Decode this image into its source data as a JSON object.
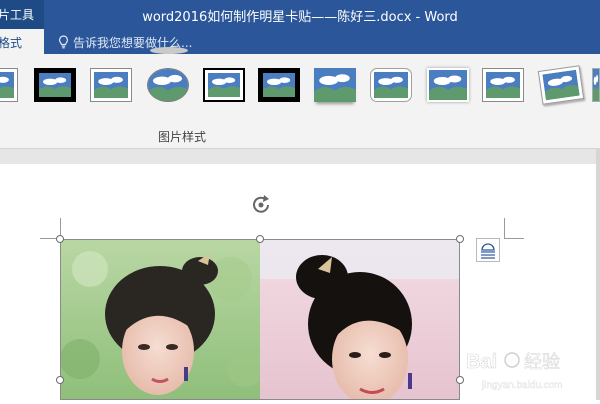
{
  "titlebar": {
    "context_group": "图片工具",
    "document_title": "word2016如何制作明星卡贴——陈好三.docx - Word",
    "active_tab": "格式",
    "tell_me_placeholder": "告诉我您想要做什么..."
  },
  "ribbon": {
    "group_label": "图片样式",
    "style_thumbnails": [
      "picture-style-simple-frame-white",
      "picture-style-simple-frame-black",
      "picture-style-thick-matte",
      "picture-style-oval",
      "picture-style-double-frame",
      "picture-style-thick-black",
      "picture-style-drop-shadow",
      "picture-style-rounded-rectangle",
      "picture-style-soft-edge",
      "picture-style-reflected",
      "picture-style-rotated-white",
      "picture-style-partial"
    ]
  },
  "watermark": {
    "brand": "Baidu",
    "brand_cn": "经验",
    "url": "jingyan.baidu.com"
  },
  "colors": {
    "title_bar": "#2b579a",
    "ribbon_bg": "#f3f3f3",
    "thumb_sky": "#4a7ec0",
    "thumb_cloud": "#ffffff",
    "thumb_hill": "#5f9a6e"
  }
}
